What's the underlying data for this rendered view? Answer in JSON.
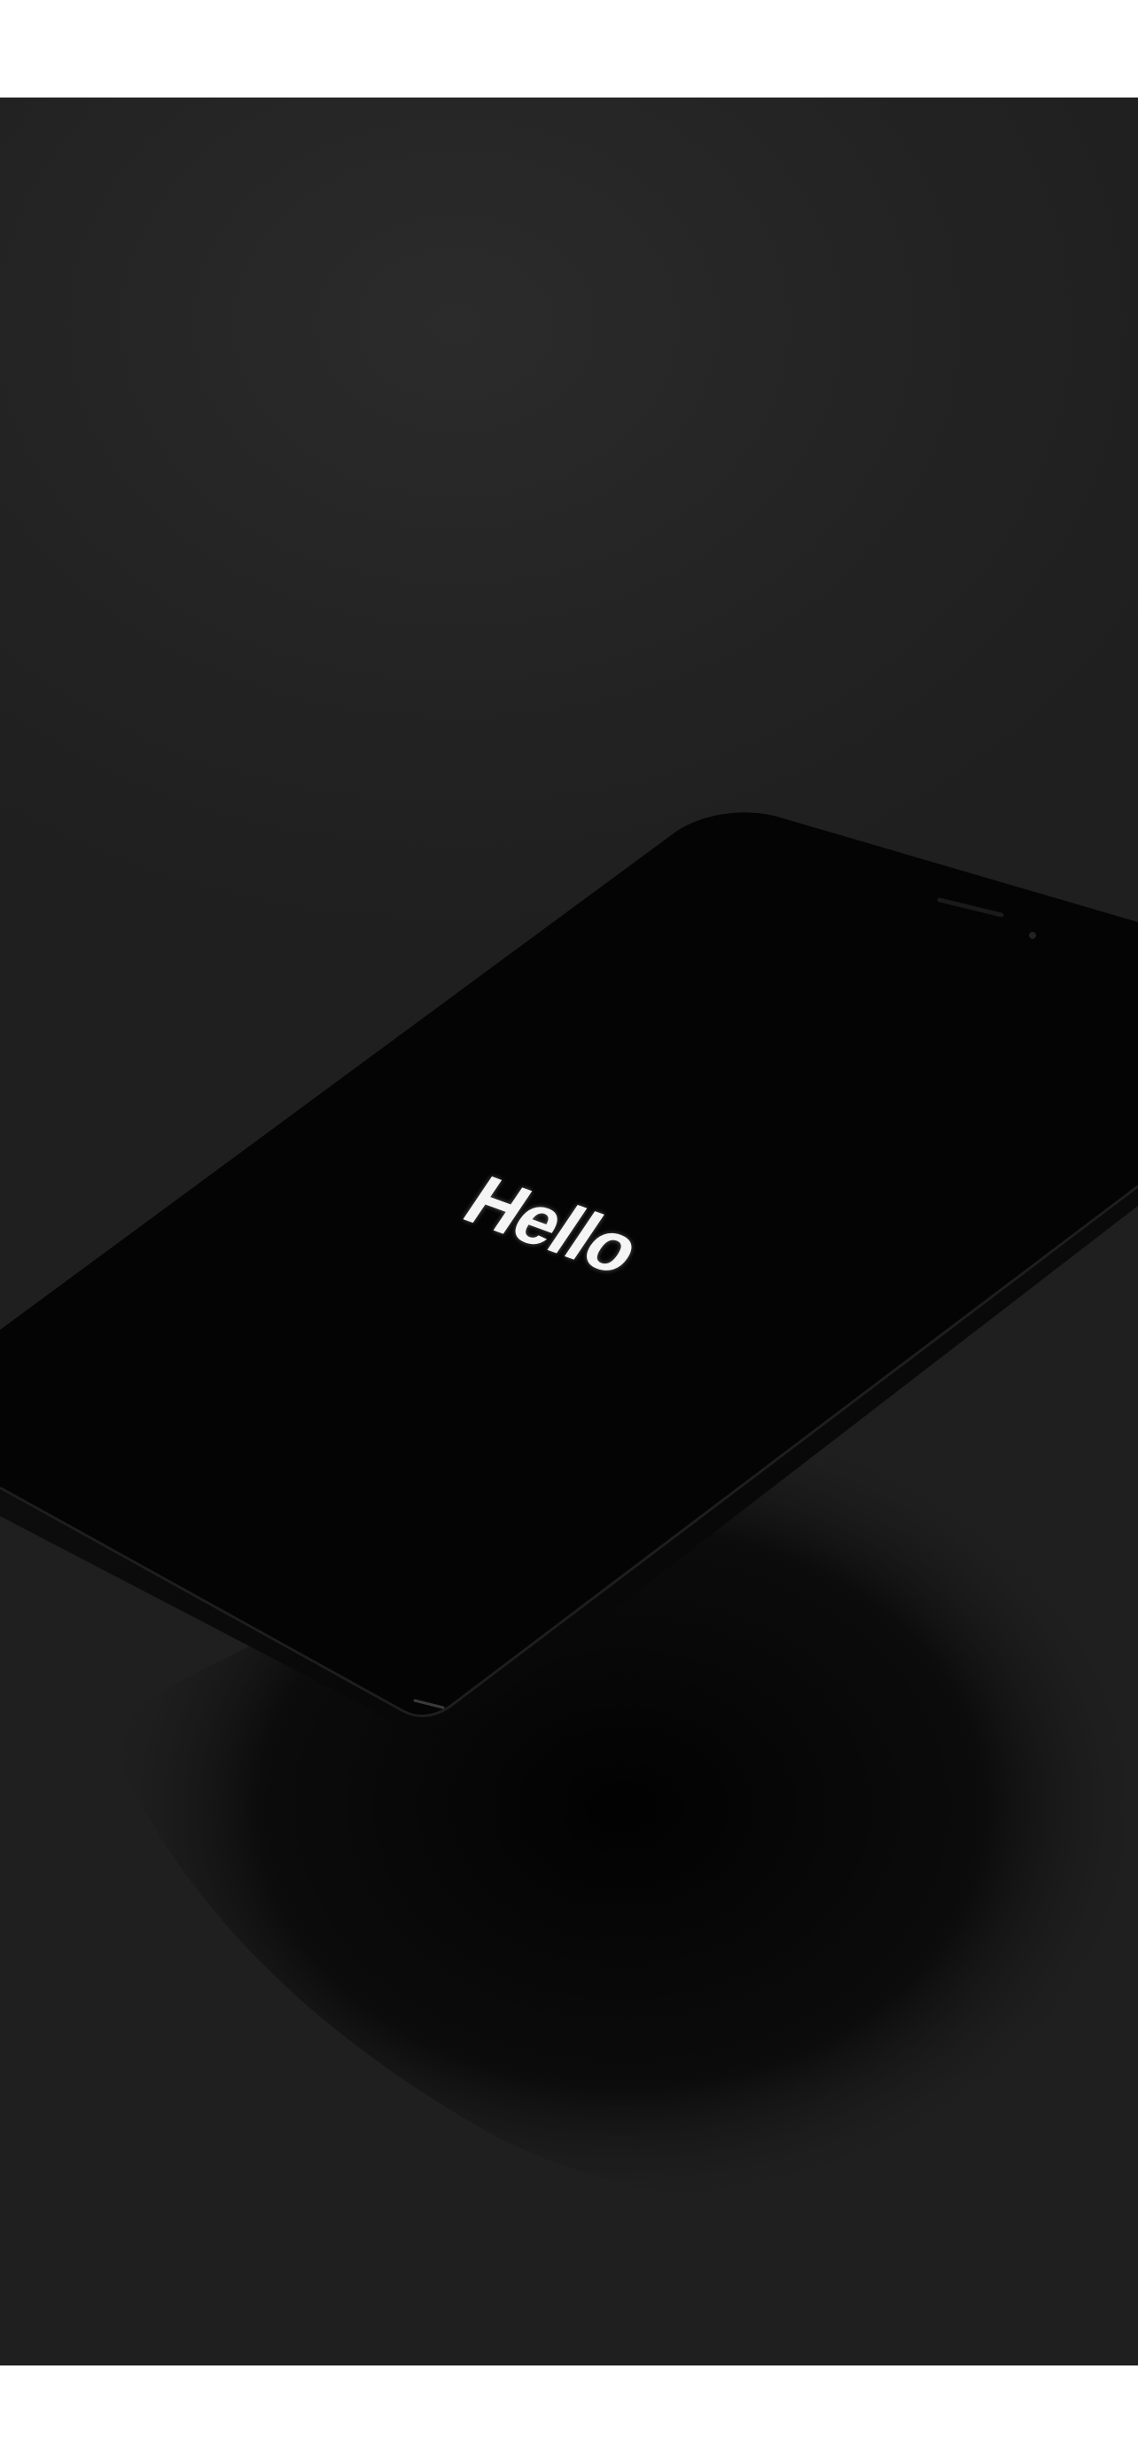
{
  "screen": {
    "text": "Hello"
  },
  "colors": {
    "backdrop": "#242424",
    "phone_body": "#050505",
    "screen_text": "#f5f5f5",
    "frame": "#ffffff"
  }
}
